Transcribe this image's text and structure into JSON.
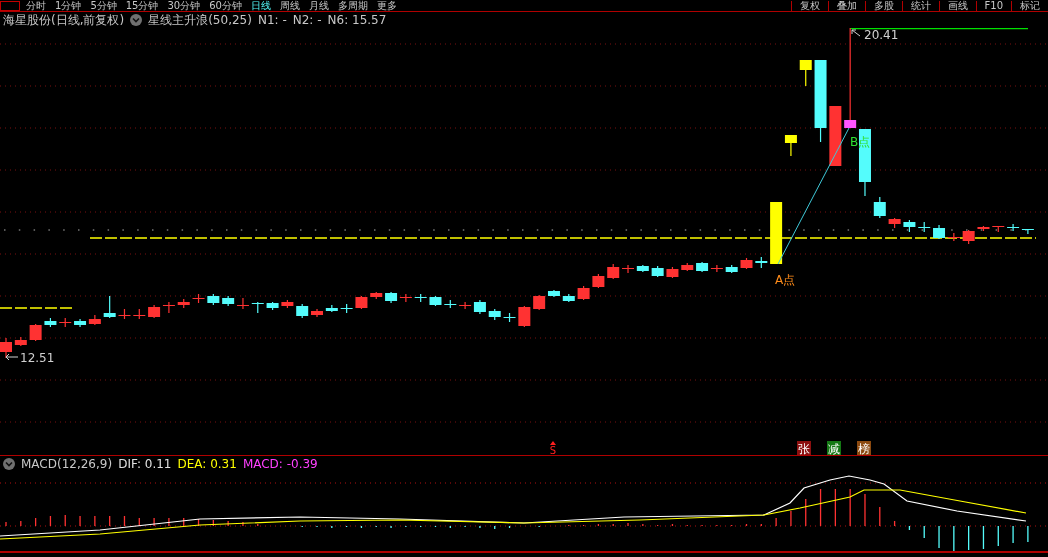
{
  "toolbar": {
    "periods": [
      {
        "label": "分时",
        "selected": false
      },
      {
        "label": "1分钟",
        "selected": false
      },
      {
        "label": "5分钟",
        "selected": false
      },
      {
        "label": "15分钟",
        "selected": false
      },
      {
        "label": "30分钟",
        "selected": false
      },
      {
        "label": "60分钟",
        "selected": false
      },
      {
        "label": "日线",
        "selected": true
      },
      {
        "label": "周线",
        "selected": false
      },
      {
        "label": "月线",
        "selected": false
      },
      {
        "label": "多周期",
        "selected": false
      },
      {
        "label": "更多",
        "selected": false
      }
    ],
    "buttons": [
      "复权",
      "叠加",
      "多股",
      "统计",
      "画线",
      "F10",
      "标记"
    ]
  },
  "title": {
    "stock": "海星股份(日线,前复权)",
    "indicator": "星线主升浪(50,25)",
    "values": [
      "N1: -",
      "N2: -",
      "N6: 15.57"
    ]
  },
  "main_chart": {
    "high_label": "20.41",
    "low_label": "12.51",
    "point_a": "A点",
    "point_b": "B点",
    "signal": "S",
    "badges": [
      {
        "text": "张",
        "color": "#8c1010"
      },
      {
        "text": "减",
        "color": "#147814"
      },
      {
        "text": "榜",
        "color": "#8c4a10"
      }
    ]
  },
  "macd": {
    "name": "MACD(12,26,9)",
    "dif": "DIF: 0.11",
    "dea": "DEA: 0.31",
    "macd": "MACD: -0.39"
  }
}
